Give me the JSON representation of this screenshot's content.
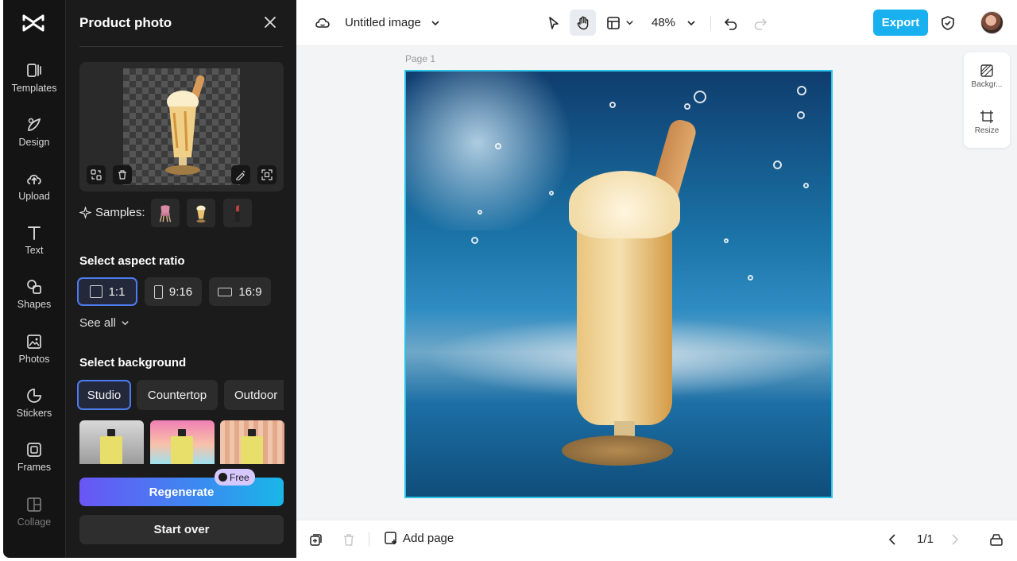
{
  "rail": {
    "items": [
      {
        "label": "Templates"
      },
      {
        "label": "Design"
      },
      {
        "label": "Upload"
      },
      {
        "label": "Text"
      },
      {
        "label": "Shapes"
      },
      {
        "label": "Photos"
      },
      {
        "label": "Stickers"
      },
      {
        "label": "Frames"
      },
      {
        "label": "Collage"
      }
    ]
  },
  "panel": {
    "title": "Product photo",
    "samples_label": "Samples:",
    "aspect_title": "Select aspect ratio",
    "ratios": [
      {
        "label": "1:1",
        "selected": true
      },
      {
        "label": "9:16",
        "selected": false
      },
      {
        "label": "16:9",
        "selected": false
      }
    ],
    "see_all": "See all",
    "background_title": "Select background",
    "bg_tabs": [
      {
        "label": "Studio",
        "selected": true
      },
      {
        "label": "Countertop",
        "selected": false
      },
      {
        "label": "Outdoor",
        "selected": false
      }
    ],
    "regenerate": "Regenerate",
    "free_badge": "Free",
    "start_over": "Start over"
  },
  "topbar": {
    "doc_title": "Untitled image",
    "zoom": "48%",
    "export": "Export"
  },
  "canvas": {
    "page_label": "Page 1",
    "side_tools": [
      {
        "label": "Backgr..."
      },
      {
        "label": "Resize"
      }
    ]
  },
  "bottombar": {
    "add_page": "Add page",
    "page_count": "1/1"
  },
  "colors": {
    "accent": "#19b0ef",
    "selection": "#4d7cf0",
    "panel_bg": "#1b1b1b"
  }
}
